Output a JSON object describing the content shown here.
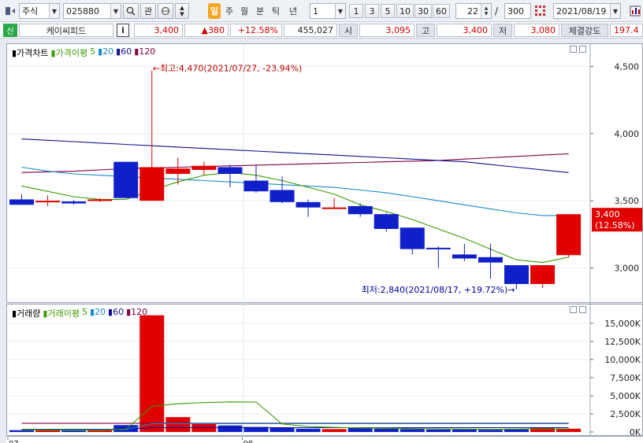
{
  "toolbar": {
    "market_select": "주식",
    "code_input": "025880",
    "interest_label": "관",
    "periods": [
      "일",
      "주",
      "월",
      "분",
      "틱",
      "년"
    ],
    "active_period": "일",
    "multiplier": "1",
    "intervals": [
      "1",
      "3",
      "5",
      "10",
      "30",
      "60"
    ],
    "count_value": "22",
    "count_separator": "/",
    "count_total": "300",
    "date_value": "2021/08/19"
  },
  "infobar": {
    "tag": "신",
    "stock_name": "케이씨피드",
    "info_btn": "i",
    "price": "3,400",
    "change": "▲380",
    "change_pct": "+12.58%",
    "volume": "455,027",
    "open_label": "시",
    "open": "3,095",
    "high_label": "고",
    "high": "3,400",
    "low_label": "저",
    "low": "3,080",
    "strength_label": "체결강도",
    "strength": "197.4"
  },
  "colors": {
    "up": "#e00000",
    "down": "#1020c8",
    "ma5": "#3a9a00",
    "ma20": "#1a8ac8",
    "ma60": "#101090",
    "ma120": "#800040"
  },
  "chart_data": [
    {
      "type": "candlestick",
      "legend": [
        {
          "label": "가격차트",
          "color": "#000000"
        },
        {
          "label": "가격이평",
          "color": "#3a9a00"
        },
        {
          "label": "5",
          "color": "#3a9a00"
        },
        {
          "label": "20",
          "color": "#1a8ac8"
        },
        {
          "label": "60",
          "color": "#101090"
        },
        {
          "label": "120",
          "color": "#800040"
        }
      ],
      "y_ticks": [
        "4,500",
        "4,000",
        "3,500",
        "3,000"
      ],
      "y_tick_values": [
        4500,
        4000,
        3500,
        3000
      ],
      "ylim": [
        2780,
        4620
      ],
      "x_tick_labels": [
        {
          "index": 0,
          "label": "07"
        },
        {
          "index": 9,
          "label": "08"
        }
      ],
      "candles": [
        {
          "o": 3510,
          "h": 3550,
          "l": 3470,
          "c": 3470
        },
        {
          "o": 3500,
          "h": 3540,
          "l": 3460,
          "c": 3500
        },
        {
          "o": 3495,
          "h": 3505,
          "l": 3470,
          "c": 3480
        },
        {
          "o": 3500,
          "h": 3520,
          "l": 3490,
          "c": 3510
        },
        {
          "o": 3790,
          "h": 3790,
          "l": 3520,
          "c": 3520
        },
        {
          "o": 3500,
          "h": 4470,
          "l": 3500,
          "c": 3750
        },
        {
          "o": 3700,
          "h": 3820,
          "l": 3620,
          "c": 3740
        },
        {
          "o": 3730,
          "h": 3790,
          "l": 3690,
          "c": 3760
        },
        {
          "o": 3750,
          "h": 3770,
          "l": 3600,
          "c": 3700
        },
        {
          "o": 3650,
          "h": 3770,
          "l": 3560,
          "c": 3570
        },
        {
          "o": 3580,
          "h": 3680,
          "l": 3480,
          "c": 3490
        },
        {
          "o": 3490,
          "h": 3510,
          "l": 3380,
          "c": 3450
        },
        {
          "o": 3450,
          "h": 3520,
          "l": 3440,
          "c": 3450
        },
        {
          "o": 3460,
          "h": 3480,
          "l": 3380,
          "c": 3400
        },
        {
          "o": 3400,
          "h": 3410,
          "l": 3270,
          "c": 3290
        },
        {
          "o": 3300,
          "h": 3300,
          "l": 3100,
          "c": 3140
        },
        {
          "o": 3150,
          "h": 3160,
          "l": 3000,
          "c": 3140
        },
        {
          "o": 3100,
          "h": 3180,
          "l": 3050,
          "c": 3070
        },
        {
          "o": 3080,
          "h": 3180,
          "l": 2920,
          "c": 3040
        },
        {
          "o": 3020,
          "h": 3020,
          "l": 2840,
          "c": 2880
        },
        {
          "o": 2880,
          "h": 3020,
          "l": 2850,
          "c": 3020
        },
        {
          "o": 3095,
          "h": 3400,
          "l": 3080,
          "c": 3400
        }
      ],
      "ma5": [
        3610,
        3570,
        3530,
        3510,
        3510,
        3580,
        3640,
        3690,
        3710,
        3690,
        3650,
        3600,
        3550,
        3470,
        3420,
        3360,
        3290,
        3220,
        3140,
        3060,
        3040,
        3080
      ],
      "ma20": [
        3750,
        3720,
        3700,
        3690,
        3680,
        3670,
        3660,
        3650,
        3640,
        3630,
        3620,
        3610,
        3600,
        3580,
        3560,
        3530,
        3500,
        3470,
        3440,
        3410,
        3390,
        3390
      ],
      "ma60": [
        3960,
        3950,
        3940,
        3930,
        3920,
        3910,
        3900,
        3890,
        3880,
        3870,
        3860,
        3850,
        3840,
        3830,
        3820,
        3810,
        3800,
        3790,
        3770,
        3750,
        3730,
        3710
      ],
      "ma120": [
        3710,
        3715,
        3720,
        3730,
        3740,
        3745,
        3750,
        3755,
        3760,
        3765,
        3770,
        3775,
        3780,
        3785,
        3790,
        3795,
        3800,
        3810,
        3820,
        3830,
        3840,
        3850
      ],
      "annotations": {
        "high": "최고:4,470(2021/07/27, -23.94%)",
        "low": "최저:2,840(2021/08/17, +19.72%)",
        "last_price": "3,400",
        "last_pct": "(12.58%)"
      }
    },
    {
      "type": "bar",
      "legend": [
        {
          "label": "거래량",
          "color": "#000000"
        },
        {
          "label": "거래이평",
          "color": "#3a9a00"
        },
        {
          "label": "5",
          "color": "#3a9a00"
        },
        {
          "label": "20",
          "color": "#1a8ac8"
        },
        {
          "label": "60",
          "color": "#101090"
        },
        {
          "label": "120",
          "color": "#800040"
        }
      ],
      "y_ticks": [
        "15,000K",
        "12,500K",
        "10,000K",
        "7,500K",
        "5,000K",
        "2,500K",
        "0K"
      ],
      "y_tick_values": [
        15000,
        12500,
        10000,
        7500,
        5000,
        2500,
        0
      ],
      "ylim": [
        0,
        16500
      ],
      "units": "K",
      "volumes": [
        250,
        220,
        200,
        220,
        950,
        16100,
        2050,
        1100,
        900,
        700,
        650,
        450,
        400,
        550,
        450,
        400,
        350,
        350,
        300,
        450,
        550,
        455
      ],
      "ma5": [
        300,
        280,
        260,
        250,
        370,
        3550,
        3900,
        4050,
        4150,
        4120,
        1100,
        760,
        640,
        550,
        520,
        470,
        430,
        400,
        370,
        380,
        420,
        420
      ],
      "ma20": [
        330,
        330,
        330,
        330,
        330,
        1150,
        1150,
        1150,
        1150,
        1150,
        1150,
        1150,
        1150,
        1150,
        1150,
        1150,
        1150,
        1150,
        1150,
        1150,
        1150,
        1150
      ],
      "ma60": [
        380,
        380,
        380,
        380,
        380,
        600,
        600,
        600,
        600,
        600,
        600,
        600,
        600,
        600,
        600,
        600,
        600,
        600,
        600,
        600,
        600,
        600
      ],
      "ma120": [
        1200,
        1200,
        1200,
        1200,
        1200,
        1200,
        1200,
        1200,
        1200,
        1200,
        1200,
        1200,
        1200,
        1200,
        1200,
        1200,
        1200,
        1200,
        1200,
        1200,
        1200,
        1200
      ]
    }
  ]
}
